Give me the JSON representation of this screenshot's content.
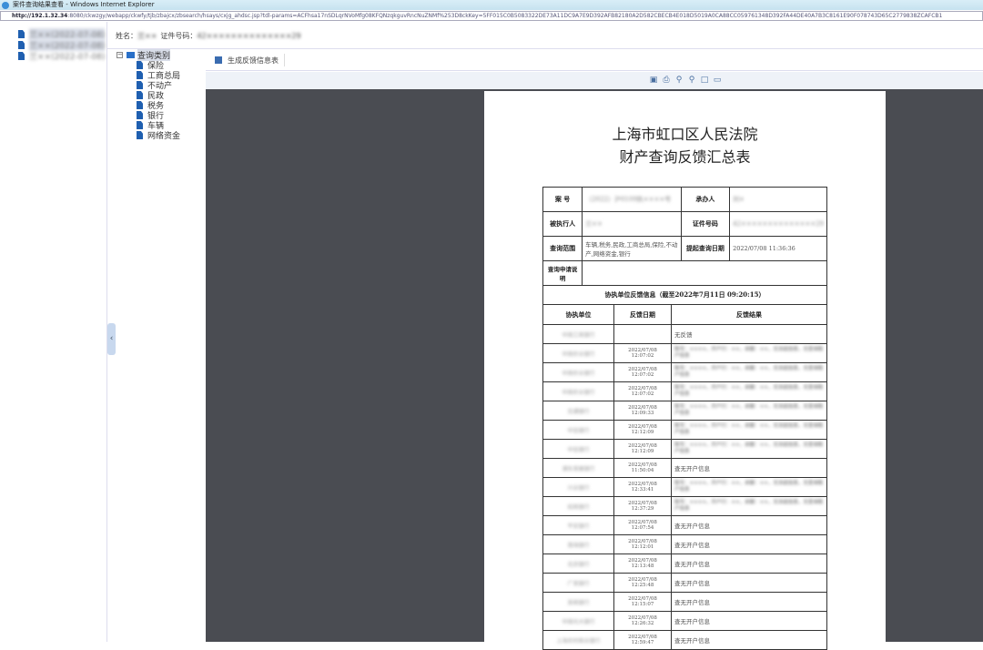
{
  "window": {
    "title": "案件查询结果查看 - Windows Internet Explorer",
    "url_host": "http://192.1.32.34",
    "url_rest": ":8080/ckwzgy/webapp/ckwfy/tjb/zbajcx/zbsearch/hsays/cxjg_ahdsc.jsp?tdl-params=ACFhsa17nSDLqrNVoMfg08KFQNzqkguvRncNuZNMf%253D8ckKey=5FF015C0B5083322DE73A11DC9A7E9D392AFB82180A2D582CBECB4E018D5019A0CA88CC059761348D392FA44DE40A7B3C8161E90F078743D65C2779838ZCAFCB1"
  },
  "left_tree": [
    {
      "label": "兰××(2022-07-08)"
    },
    {
      "label": "兰××(2022-07-08)"
    },
    {
      "label": "兰××(2022-07-08)"
    }
  ],
  "info": {
    "name_label": "姓名：",
    "name_value": "兰××",
    "id_label": "证件号码：",
    "id_value": "42××××××××××××××29"
  },
  "categories": {
    "root": "查询类别",
    "items": [
      "保险",
      "工商总局",
      "不动产",
      "民政",
      "税务",
      "银行",
      "车辆",
      "网络资金"
    ]
  },
  "toolbar": {
    "generate_label": "生成反馈信息表"
  },
  "report": {
    "title1": "上海市虹口区人民法院",
    "title2": "财产查询反馈汇总表",
    "case_no_label": "案 号",
    "case_no": "（2022）沪0109执××××号",
    "handler_label": "承办人",
    "handler": "刘×",
    "debtor_label": "被执行人",
    "debtor": "兰××",
    "id_label": "证件号码",
    "id_value": "42××××××××××××××29",
    "scope_label": "查询范围",
    "scope": "车辆,税务,民政,工商总局,保险,不动产,网络资金,银行",
    "date_label": "提起查询日期",
    "date": "2022/07/08 11:36:36",
    "note_label": "查询申请说明",
    "feedback_header": "协执单位反馈信息（截至2022年7月11日 09:20:15）",
    "col_unit": "协执单位",
    "col_date": "反馈日期",
    "col_result": "反馈结果",
    "rows": [
      {
        "unit": "中国工商银行",
        "date": "",
        "result": "无反馈",
        "blur": false
      },
      {
        "unit": "中国农业银行",
        "date": "2022/07/08 12:07:02",
        "result": "账号：××××，开户行：××，余额：××，无冻结信息，无查询账户信息",
        "blur": true
      },
      {
        "unit": "中国农业银行",
        "date": "2022/07/08 12:07:02",
        "result": "账号：××××，开户行：××，余额：××，无冻结信息，无查询账户信息",
        "blur": true
      },
      {
        "unit": "中国农业银行",
        "date": "2022/07/08 12:07:02",
        "result": "账号：××××，开户行：××，余额：××，无冻结信息，无查询账户信息",
        "blur": true
      },
      {
        "unit": "交通银行",
        "date": "2022/07/08 12:09:33",
        "result": "账号：××××，开户行：××，余额：××，无冻结信息，无查询账户信息",
        "blur": true
      },
      {
        "unit": "中信银行",
        "date": "2022/07/08 12:12:09",
        "result": "账号：××××，开户行：××，余额：××，无冻结信息，无查询账户信息",
        "blur": true
      },
      {
        "unit": "中信银行",
        "date": "2022/07/08 12:12:09",
        "result": "账号：××××，开户行：××，余额：××，无冻结信息，无查询账户信息",
        "blur": true
      },
      {
        "unit": "浦东发展银行",
        "date": "2022/07/08 11:50:04",
        "result": "查无开户信息",
        "blur": false
      },
      {
        "unit": "兴业银行",
        "date": "2022/07/08 12:33:41",
        "result": "账号：××××，开户行：××，余额：××，无冻结信息，无查询账户信息",
        "blur": true
      },
      {
        "unit": "招商银行",
        "date": "2022/07/08 12:37:29",
        "result": "账号：××××，开户行：××，余额：××，无冻结信息，无查询账户信息",
        "blur": true
      },
      {
        "unit": "平安银行",
        "date": "2022/07/08 12:07:54",
        "result": "查无开户信息",
        "blur": false
      },
      {
        "unit": "渤海银行",
        "date": "2022/07/08 12:12:01",
        "result": "查无开户信息",
        "blur": false
      },
      {
        "unit": "北京银行",
        "date": "2022/07/08 12:13:48",
        "result": "查无开户信息",
        "blur": false
      },
      {
        "unit": "广发银行",
        "date": "2022/07/08 12:25:48",
        "result": "查无开户信息",
        "blur": false
      },
      {
        "unit": "浙商银行",
        "date": "2022/07/08 12:15:07",
        "result": "查无开户信息",
        "blur": false
      },
      {
        "unit": "中国光大银行",
        "date": "2022/07/08 12:26:32",
        "result": "查无开户信息",
        "blur": false
      },
      {
        "unit": "上海农村商业银行",
        "date": "2022/07/08 12:59:47",
        "result": "查无开户信息",
        "blur": false
      }
    ]
  }
}
